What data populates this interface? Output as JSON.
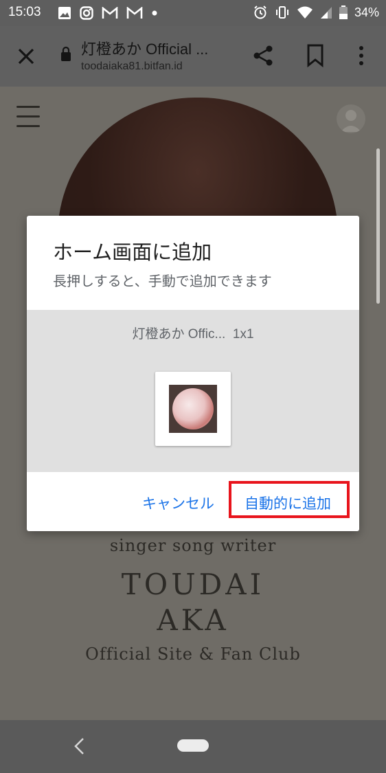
{
  "status": {
    "time": "15:03",
    "battery": "34%",
    "icons_left": [
      "image-icon",
      "instagram-icon",
      "gmail-icon",
      "gmail-icon",
      "dot-icon"
    ],
    "icons_right": [
      "alarm-icon",
      "vibrate-icon",
      "wifi-icon",
      "signal-icon",
      "battery-icon"
    ]
  },
  "toolbar": {
    "title": "灯橙あか Official ...",
    "url": "toodaiaka81.bitfan.id"
  },
  "page": {
    "tagline": "singer song writer",
    "brand_line1": "TOUDAI",
    "brand_line2": "AKA",
    "subtitle": "Official Site & Fan Club"
  },
  "dialog": {
    "title": "ホーム画面に追加",
    "subtitle": "長押しすると、手動で追加できます",
    "preview_label": "灯橙あか Offic...",
    "preview_size": "1x1",
    "cancel_label": "キャンセル",
    "add_label": "自動的に追加"
  },
  "colors": {
    "accent": "#1a73e8",
    "highlight": "#e8141c"
  }
}
